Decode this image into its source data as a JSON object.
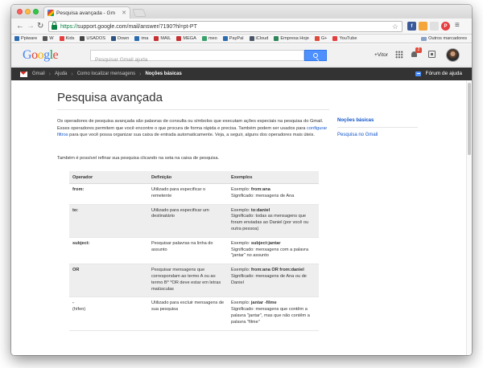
{
  "browser": {
    "tab_title": "Pesquisa avançada - Gm",
    "url_protocol": "https://",
    "url_rest": "support.google.com/mail/answer/7190?hl=pt-PT",
    "extensions": [
      "f",
      "",
      "",
      "P"
    ]
  },
  "bookmarks": {
    "items": [
      {
        "label": "Ppiware",
        "color": "#2b6cb0"
      },
      {
        "label": "W",
        "color": "#555555"
      },
      {
        "label": "Kids",
        "color": "#e53e3e"
      },
      {
        "label": "USADOS",
        "color": "#444444"
      },
      {
        "label": "Down",
        "color": "#2c5282"
      },
      {
        "label": "ima",
        "color": "#2b6cb0"
      },
      {
        "label": "MAIL",
        "color": "#c53030"
      },
      {
        "label": "MEGA",
        "color": "#c53030"
      },
      {
        "label": "meo",
        "color": "#38a169"
      },
      {
        "label": "PayPal",
        "color": "#2b6cb0"
      },
      {
        "label": "iCloud",
        "color": "#4a5568"
      },
      {
        "label": "Empresa Hoje",
        "color": "#2f855a"
      },
      {
        "label": "G+",
        "color": "#dd4b39"
      },
      {
        "label": "YouTube",
        "color": "#e53e3e"
      }
    ],
    "other": "Outros marcadores"
  },
  "header": {
    "logo_letters": [
      {
        "ch": "G",
        "color": "#4285f4"
      },
      {
        "ch": "o",
        "color": "#db4437"
      },
      {
        "ch": "o",
        "color": "#f4b400"
      },
      {
        "ch": "g",
        "color": "#4285f4"
      },
      {
        "ch": "l",
        "color": "#0f9d58"
      },
      {
        "ch": "e",
        "color": "#db4437"
      }
    ],
    "search_placeholder": "Pesquisar Gmail ajuda",
    "user": "+Vitor",
    "notification_count": "2"
  },
  "breadcrumb": {
    "items": [
      "Gmail",
      "Ajuda",
      "Como localizar mensagens",
      "Noções básicas"
    ],
    "forum": "Fórum de ajuda"
  },
  "article": {
    "title": "Pesquisa avançada",
    "p1_before": "Os operadores de pesquisa avançada são palavras de consulta ou símbolos que executam ações especiais na pesquisa do Gmail. Esses operadores permitem que você encontre o que procura de forma rápida e precisa. Também podem ser usados para ",
    "p1_link": "configurar filtros",
    "p1_after": " para que você possa organizar sua caixa de entrada automaticamente. Veja, a seguir, alguns dos operadores mais úteis.",
    "p2": "Também é possível refinar sua pesquisa clicando na seta na caixa de pesquisa."
  },
  "toc": {
    "items": [
      "Noções básicas",
      "Pesquisa no Gmail"
    ]
  },
  "table": {
    "headers": [
      "Operador",
      "Definição",
      "Exemplos"
    ],
    "rows": [
      {
        "operator": "from:",
        "operator_note": "",
        "definition": "Utilizado para especificar o remetente",
        "example_prefix": "Exemplo: ",
        "example_code": "from:ana",
        "meaning": "Significado: mensagens de Ana"
      },
      {
        "operator": "to:",
        "operator_note": "",
        "definition": "Utilizado para especificar um destinatário",
        "example_prefix": "Exemplo: ",
        "example_code": "to:daniel",
        "meaning": "Significado: todas as mensagens que foram enviadas ao Daniel (por você ou outra pessoa)"
      },
      {
        "operator": "subject:",
        "operator_note": "",
        "definition": "Pesquisar palavras na linha do assunto",
        "example_prefix": "Exemplo: ",
        "example_code": "subject:jantar",
        "meaning": "Significado: mensagens com a palavra \"jantar\" no assunto"
      },
      {
        "operator": "OR",
        "operator_note": "",
        "definition": "Pesquisar mensagens que correspondam ao termo A ou ao termo B* *OR deve estar em letras maiúsculas",
        "example_prefix": "Exemplo: ",
        "example_code": "from:ana OR from:daniel",
        "meaning": "Significado: mensagens de Ana ou de Daniel"
      },
      {
        "operator": "-",
        "operator_note": "(hífen)",
        "definition": "Utilizado para excluir mensagens de sua pesquisa",
        "example_prefix": "Exemplo: ",
        "example_code": "jantar -filme",
        "meaning": "Significado: mensagens que contêm a palavra \"jantar\", mas que não contêm a palavra \"filme\""
      }
    ]
  }
}
